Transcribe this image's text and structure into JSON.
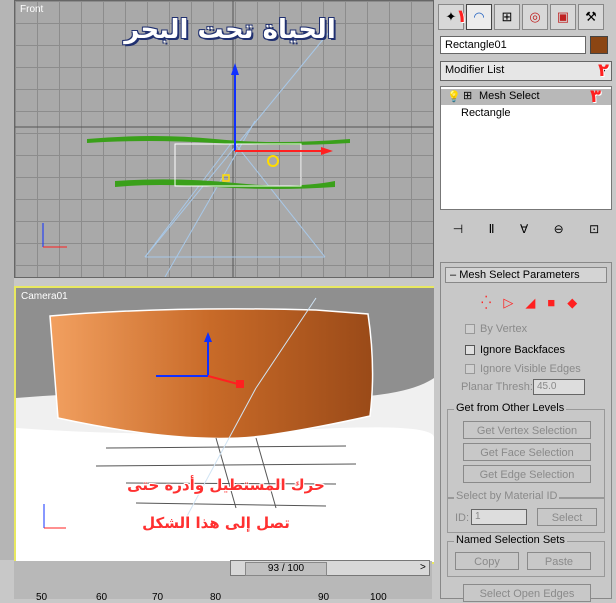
{
  "front_viewport": {
    "label": "Front",
    "overlay_title": "الحياة تحت البحر"
  },
  "camera_viewport": {
    "label": "Camera01",
    "caption_line1": "حرك المستطيل وأدره حتى",
    "caption_line2": "تصل إلى هذا الشكل"
  },
  "annotations": {
    "n1": "١",
    "n2": "٢",
    "n3": "٣"
  },
  "panel": {
    "tabs": [
      "create-icon",
      "modify-icon",
      "hierarchy-icon",
      "motion-icon",
      "display-icon",
      "utilities-icon"
    ],
    "object_name": "Rectangle01",
    "object_color": "#8b4513",
    "modifier_list": "Modifier List",
    "stack": {
      "item1": "Mesh Select",
      "item2": "Rectangle"
    },
    "rollout_title": "Mesh Select Parameters",
    "by_vertex": "By Vertex",
    "ignore_backfaces": "Ignore Backfaces",
    "ignore_visible_edges": "Ignore Visible Edges",
    "planar_thresh_label": "Planar Thresh:",
    "planar_thresh_value": "45.0",
    "get_levels_title": "Get from Other Levels",
    "get_vertex": "Get Vertex Selection",
    "get_face": "Get Face Selection",
    "get_edge": "Get Edge Selection",
    "select_by_material_title": "Select by Material ID",
    "id_label": "ID:",
    "id_value": "1",
    "select_btn": "Select",
    "named_sets_title": "Named Selection Sets",
    "copy_btn": "Copy",
    "paste_btn": "Paste",
    "select_open_edges": "Select Open Edges"
  },
  "timeline": {
    "frame": "93 / 100",
    "ticks": [
      "50",
      "60",
      "70",
      "80",
      "90",
      "100"
    ]
  }
}
